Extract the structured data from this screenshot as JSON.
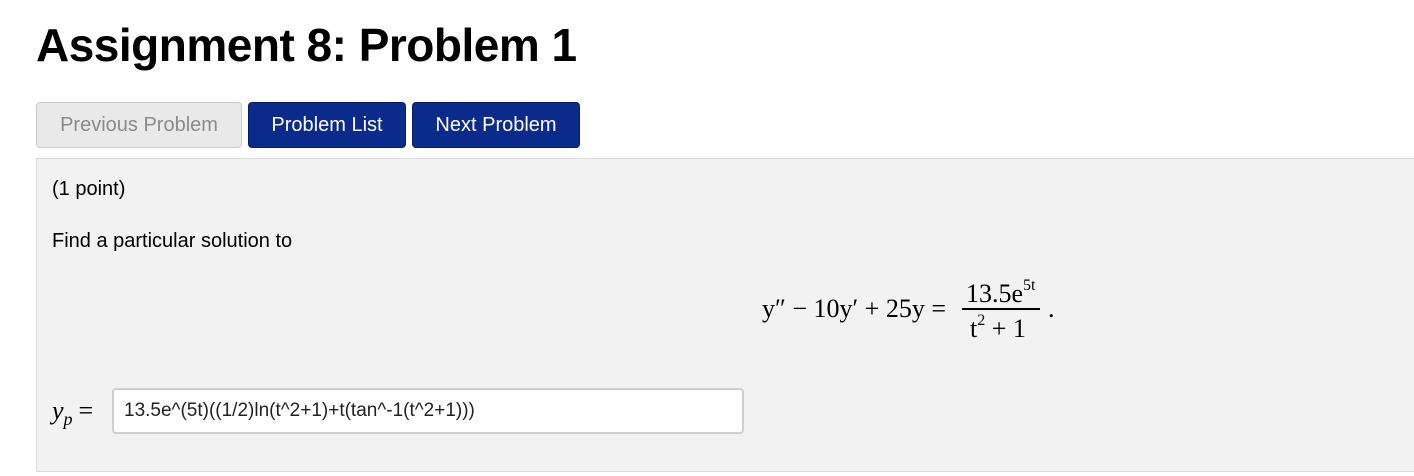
{
  "page": {
    "title": "Assignment 8: Problem 1"
  },
  "nav": {
    "previous_label": "Previous Problem",
    "list_label": "Problem List",
    "next_label": "Next Problem"
  },
  "problem": {
    "points": "(1 point)",
    "prompt": "Find a particular solution to",
    "equation": {
      "lhs": "y″ − 10y′ + 25y =",
      "numerator_base": "13.5e",
      "numerator_exp": "5t",
      "denominator_base": "t",
      "denominator_exp": "2",
      "denominator_tail": " + 1",
      "terminator": "."
    },
    "answer_label_var": "y",
    "answer_label_sub": "p",
    "answer_label_eq": "=",
    "answer_value": "13.5e^(5t)((1/2)ln(t^2+1)+t(tan^-1(t^2+1)))"
  },
  "colors": {
    "primary_button": "#0b2b8c",
    "disabled_button": "#e9e9e9",
    "panel_background": "#f2f2f2"
  }
}
